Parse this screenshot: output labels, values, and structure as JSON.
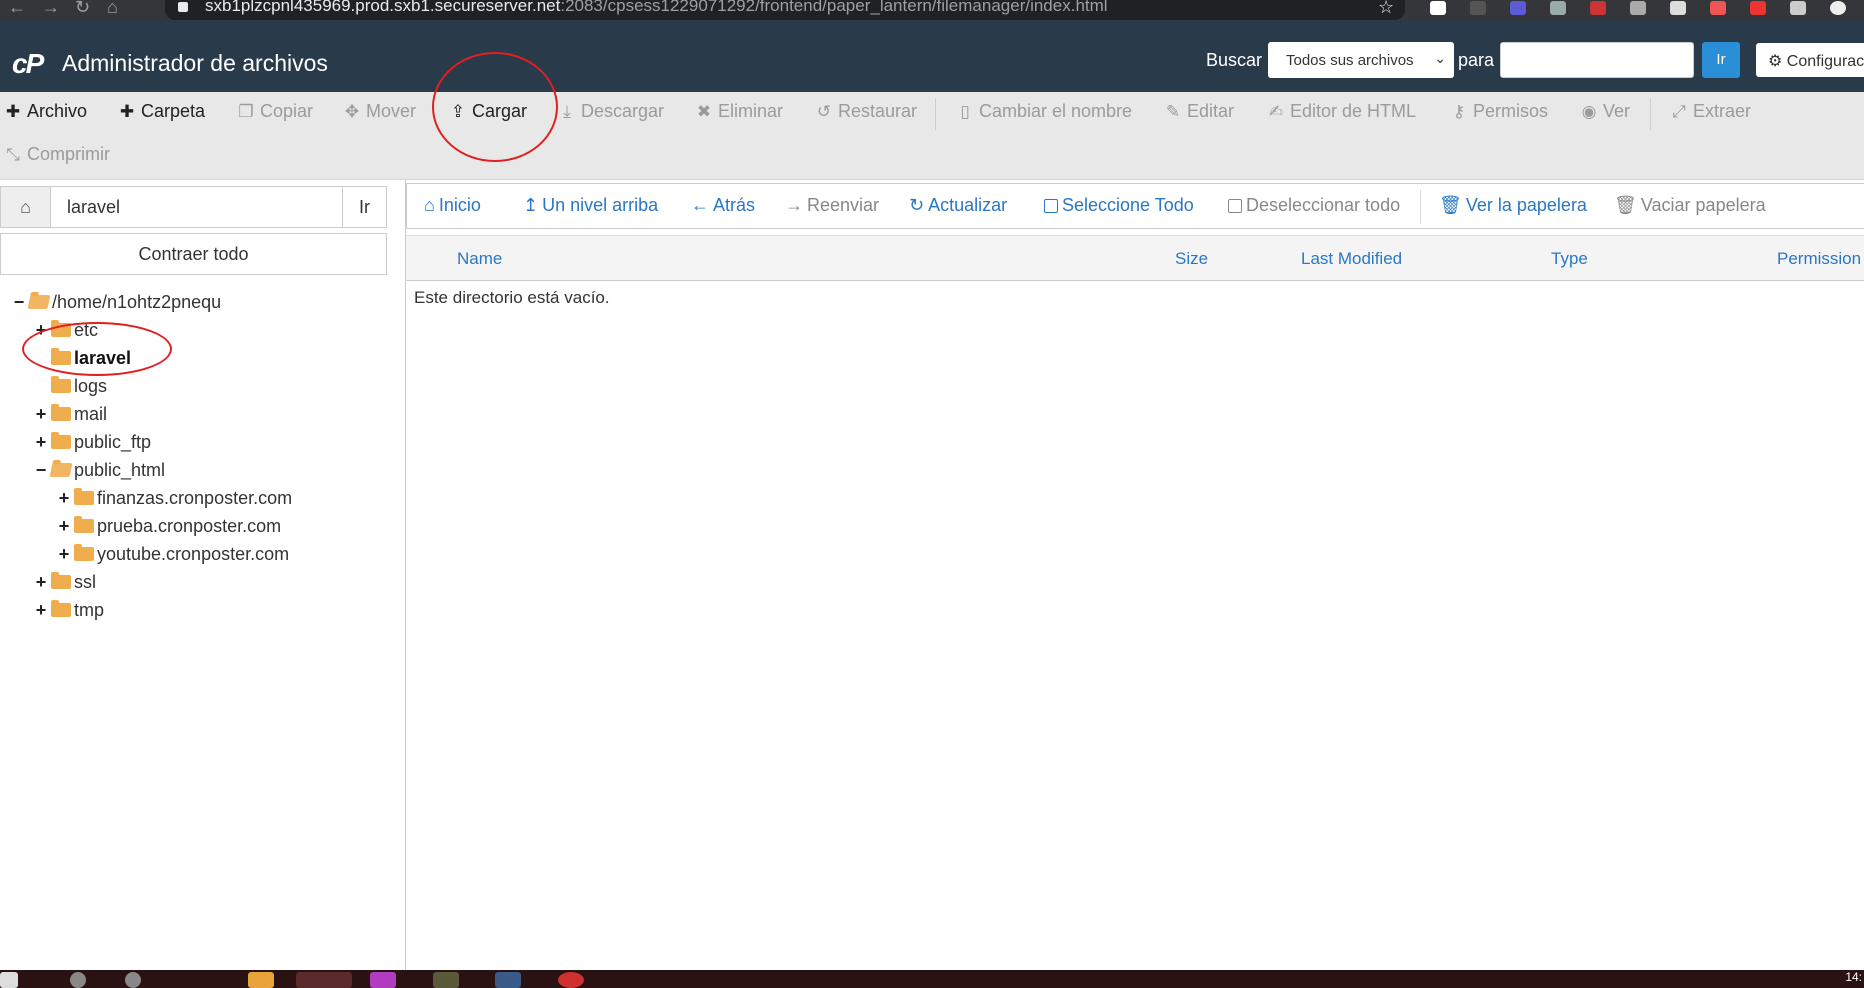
{
  "browser": {
    "url_host": "sxb1plzcpnl435969.prod.sxb1.secureserver.net",
    "url_path": ":2083/cpsess1229071292/frontend/paper_lantern/filemanager/index.html"
  },
  "header": {
    "logo_text": "cP",
    "title": "Administrador de archivos",
    "search_label": "Buscar",
    "search_scope": "Todos sus archivos",
    "para_label": "para",
    "search_placeholder": "",
    "go_label": "Ir",
    "settings_label": "Configurac"
  },
  "toolbar": {
    "archivo": "Archivo",
    "carpeta": "Carpeta",
    "copiar": "Copiar",
    "mover": "Mover",
    "cargar": "Cargar",
    "descargar": "Descargar",
    "eliminar": "Eliminar",
    "restaurar": "Restaurar",
    "cambiar_nombre": "Cambiar el nombre",
    "editar": "Editar",
    "editor_html": "Editor de HTML",
    "permisos": "Permisos",
    "ver": "Ver",
    "extraer": "Extraer",
    "comprimir": "Comprimir"
  },
  "sidebar": {
    "path_value": "laravel",
    "path_go": "Ir",
    "collapse_all": "Contraer todo",
    "tree": [
      {
        "label": "/home/n1ohtz2pnequ",
        "toggle": "−"
      },
      {
        "label": "etc",
        "toggle": "+"
      },
      {
        "label": "laravel",
        "toggle": ""
      },
      {
        "label": "logs",
        "toggle": ""
      },
      {
        "label": "mail",
        "toggle": "+"
      },
      {
        "label": "public_ftp",
        "toggle": "+"
      },
      {
        "label": "public_html",
        "toggle": "−"
      },
      {
        "label": "finanzas.cronposter.com",
        "toggle": "+"
      },
      {
        "label": "prueba.cronposter.com",
        "toggle": "+"
      },
      {
        "label": "youtube.cronposter.com",
        "toggle": "+"
      },
      {
        "label": "ssl",
        "toggle": "+"
      },
      {
        "label": "tmp",
        "toggle": "+"
      }
    ]
  },
  "navbar": {
    "inicio": "Inicio",
    "up": "Un nivel arriba",
    "back": "Atrás",
    "forward": "Reenviar",
    "refresh": "Actualizar",
    "select_all": "Seleccione Todo",
    "deselect_all": "Deseleccionar todo",
    "view_trash": "Ver la papelera",
    "empty_trash": "Vaciar papelera"
  },
  "table": {
    "columns": [
      "Name",
      "Size",
      "Last Modified",
      "Type",
      "Permission"
    ],
    "empty_message": "Este directorio está vacío."
  },
  "taskbar": {
    "clock": "14:"
  },
  "colors": {
    "header_bg": "#293a4a",
    "link_blue": "#2a77c5",
    "go_button": "#2a8fd6",
    "folder": "#f0ad4e",
    "annotation": "#e02020"
  }
}
